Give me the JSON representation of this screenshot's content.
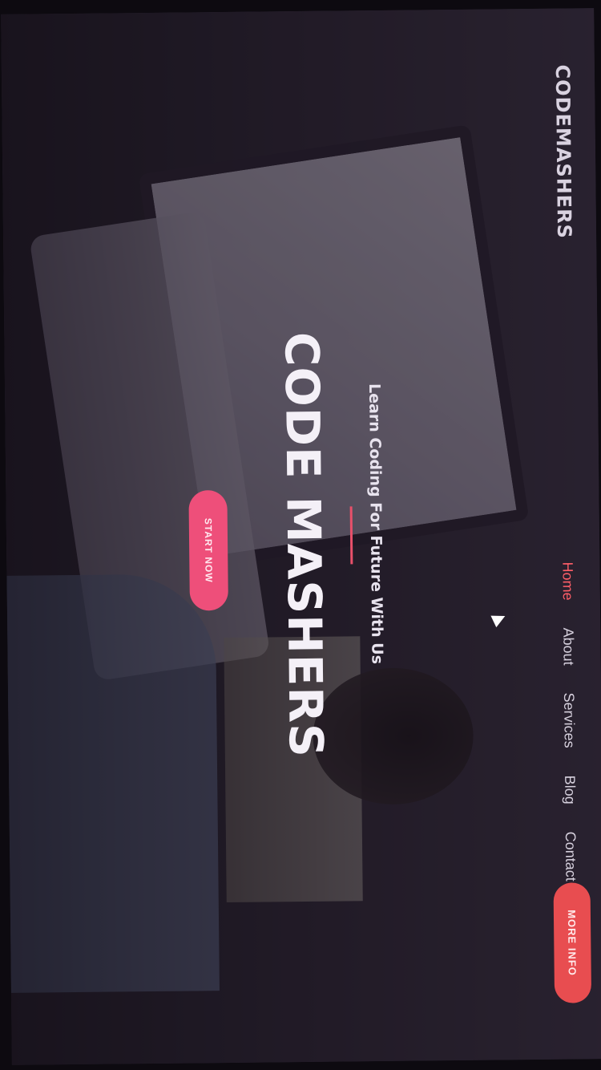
{
  "header": {
    "brand": "CODEMASHERS",
    "nav": [
      {
        "label": "Home",
        "active": true
      },
      {
        "label": "About",
        "active": false
      },
      {
        "label": "Services",
        "active": false
      },
      {
        "label": "Blog",
        "active": false
      },
      {
        "label": "Contact",
        "active": false
      }
    ],
    "more_info_label": "MORE INFO"
  },
  "hero": {
    "tagline": "Learn Coding For Future With Us",
    "title": "CODE MASHERS",
    "cta_label": "START NOW"
  },
  "colors": {
    "accent": "#ff5e68",
    "more_info_button": "#e84d50",
    "start_button": "#ee4f7a",
    "divider": "#e8506a"
  },
  "icons": {
    "cursor": "mouse-pointer-icon"
  }
}
